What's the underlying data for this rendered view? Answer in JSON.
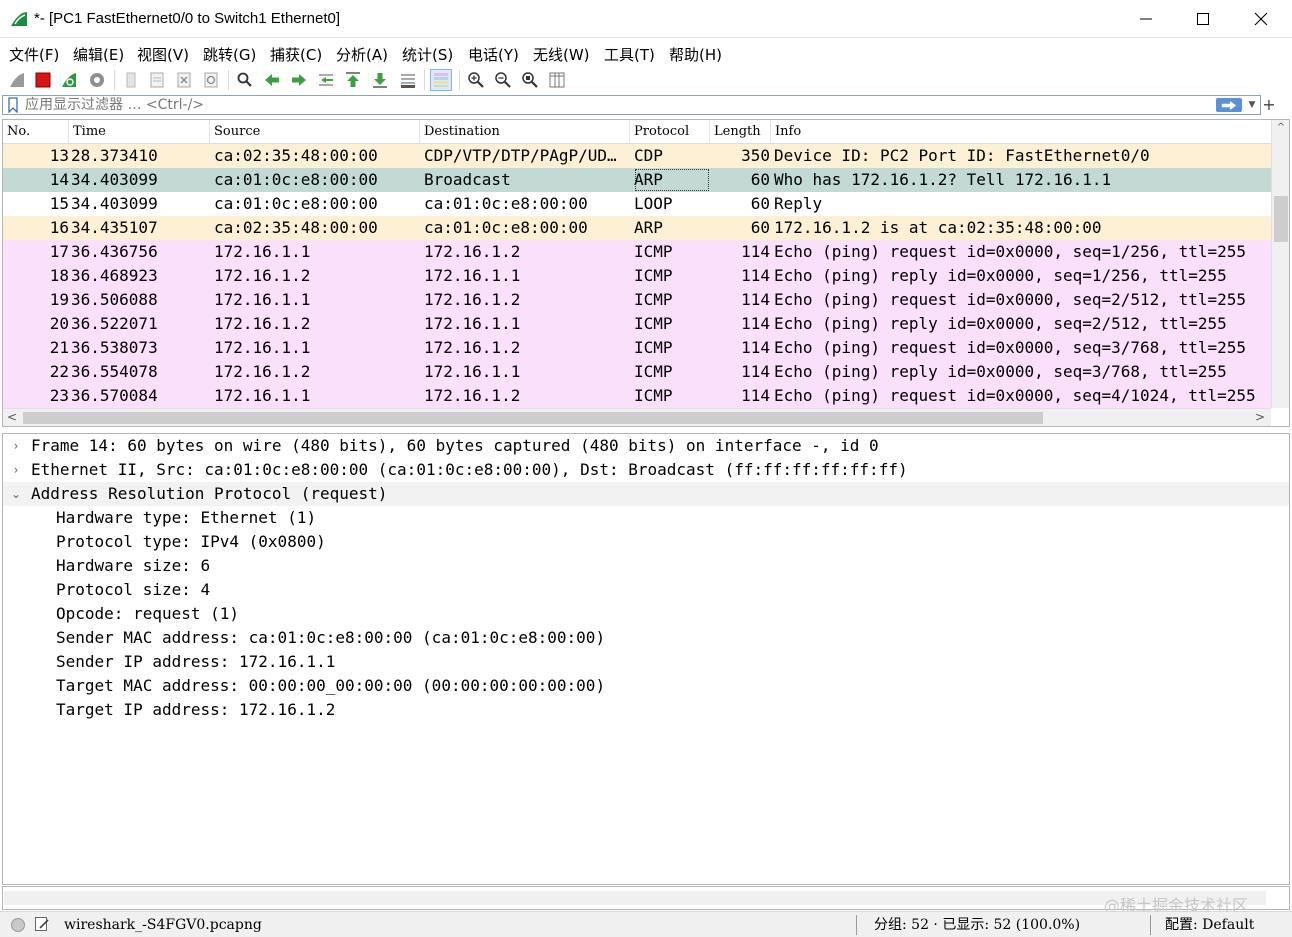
{
  "window": {
    "title": "*- [PC1 FastEthernet0/0 to Switch1 Ethernet0]",
    "icon": "wireshark-fin-icon",
    "controls": [
      "minimize-icon",
      "maximize-icon",
      "close-icon"
    ]
  },
  "menu": [
    "文件(F)",
    "编辑(E)",
    "视图(V)",
    "跳转(G)",
    "捕获(C)",
    "分析(A)",
    "统计(S)",
    "电话(Y)",
    "无线(W)",
    "工具(T)",
    "帮助(H)"
  ],
  "toolbar": {
    "icons": [
      "start-capture-icon",
      "stop-capture-icon",
      "restart-capture-icon",
      "capture-options-icon",
      "open-file-icon",
      "save-file-icon",
      "close-file-icon",
      "reload-file-icon",
      "find-packet-icon",
      "go-back-icon",
      "go-forward-icon",
      "go-to-packet-icon",
      "first-packet-icon",
      "last-packet-icon",
      "autoscroll-icon",
      "colorize-icon",
      "zoom-in-icon",
      "zoom-out-icon",
      "normal-size-icon",
      "resize-columns-icon"
    ]
  },
  "filter": {
    "placeholder": "应用显示过滤器 … <Ctrl-/>",
    "value": "",
    "add_label": "+"
  },
  "packet_list": {
    "columns": [
      "No.",
      "Time",
      "Source",
      "Destination",
      "Protocol",
      "Length",
      "Info"
    ],
    "rows": [
      {
        "no": "13",
        "time": "28.373410",
        "src": "ca:02:35:48:00:00",
        "dst": "CDP/VTP/DTP/PAgP/UD…",
        "proto": "CDP",
        "len": "350",
        "info": "Device ID: PC2  Port ID: FastEthernet0/0",
        "bg": "#fdf0d5"
      },
      {
        "no": "14",
        "time": "34.403099",
        "src": "ca:01:0c:e8:00:00",
        "dst": "Broadcast",
        "proto": "ARP",
        "len": "60",
        "info": "Who has 172.16.1.2? Tell 172.16.1.1",
        "bg": "#c3d9d3"
      },
      {
        "no": "15",
        "time": "34.403099",
        "src": "ca:01:0c:e8:00:00",
        "dst": "ca:01:0c:e8:00:00",
        "proto": "LOOP",
        "len": "60",
        "info": "Reply",
        "bg": "#ffffff"
      },
      {
        "no": "16",
        "time": "34.435107",
        "src": "ca:02:35:48:00:00",
        "dst": "ca:01:0c:e8:00:00",
        "proto": "ARP",
        "len": "60",
        "info": "172.16.1.2 is at ca:02:35:48:00:00",
        "bg": "#fdf0d5"
      },
      {
        "no": "17",
        "time": "36.436756",
        "src": "172.16.1.1",
        "dst": "172.16.1.2",
        "proto": "ICMP",
        "len": "114",
        "info": "Echo (ping) request  id=0x0000, seq=1/256, ttl=255",
        "bg": "#fbe0fb"
      },
      {
        "no": "18",
        "time": "36.468923",
        "src": "172.16.1.2",
        "dst": "172.16.1.1",
        "proto": "ICMP",
        "len": "114",
        "info": "Echo (ping) reply    id=0x0000, seq=1/256, ttl=255",
        "bg": "#fbe0fb"
      },
      {
        "no": "19",
        "time": "36.506088",
        "src": "172.16.1.1",
        "dst": "172.16.1.2",
        "proto": "ICMP",
        "len": "114",
        "info": "Echo (ping) request  id=0x0000, seq=2/512, ttl=255",
        "bg": "#fbe0fb"
      },
      {
        "no": "20",
        "time": "36.522071",
        "src": "172.16.1.2",
        "dst": "172.16.1.1",
        "proto": "ICMP",
        "len": "114",
        "info": "Echo (ping) reply    id=0x0000, seq=2/512, ttl=255",
        "bg": "#fbe0fb"
      },
      {
        "no": "21",
        "time": "36.538073",
        "src": "172.16.1.1",
        "dst": "172.16.1.2",
        "proto": "ICMP",
        "len": "114",
        "info": "Echo (ping) request  id=0x0000, seq=3/768, ttl=255",
        "bg": "#fbe0fb"
      },
      {
        "no": "22",
        "time": "36.554078",
        "src": "172.16.1.2",
        "dst": "172.16.1.1",
        "proto": "ICMP",
        "len": "114",
        "info": "Echo (ping) reply    id=0x0000, seq=3/768, ttl=255",
        "bg": "#fbe0fb"
      },
      {
        "no": "23",
        "time": "36.570084",
        "src": "172.16.1.1",
        "dst": "172.16.1.2",
        "proto": "ICMP",
        "len": "114",
        "info": "Echo (ping) request  id=0x0000, seq=4/1024, ttl=255",
        "bg": "#fbe0fb"
      }
    ]
  },
  "details": [
    {
      "text": "Frame 14: 60 bytes on wire (480 bits), 60 bytes captured (480 bits) on interface -, id 0",
      "arrow": "›",
      "indent": 0
    },
    {
      "text": "Ethernet II, Src: ca:01:0c:e8:00:00 (ca:01:0c:e8:00:00), Dst: Broadcast (ff:ff:ff:ff:ff:ff)",
      "arrow": "›",
      "indent": 0
    },
    {
      "text": "Address Resolution Protocol (request)",
      "arrow": "⌄",
      "indent": 0
    },
    {
      "text": "Hardware type: Ethernet (1)",
      "arrow": "",
      "indent": 1
    },
    {
      "text": "Protocol type: IPv4 (0x0800)",
      "arrow": "",
      "indent": 1
    },
    {
      "text": "Hardware size: 6",
      "arrow": "",
      "indent": 1
    },
    {
      "text": "Protocol size: 4",
      "arrow": "",
      "indent": 1
    },
    {
      "text": "Opcode: request (1)",
      "arrow": "",
      "indent": 1
    },
    {
      "text": "Sender MAC address: ca:01:0c:e8:00:00 (ca:01:0c:e8:00:00)",
      "arrow": "",
      "indent": 1
    },
    {
      "text": "Sender IP address: 172.16.1.1",
      "arrow": "",
      "indent": 1
    },
    {
      "text": "Target MAC address: 00:00:00_00:00:00 (00:00:00:00:00:00)",
      "arrow": "",
      "indent": 1
    },
    {
      "text": "Target IP address: 172.16.1.2",
      "arrow": "",
      "indent": 1
    }
  ],
  "statusbar": {
    "file": "wireshark_-S4FGV0.pcapng",
    "packets": "分组: 52 · 已显示: 52 (100.0%)",
    "profile": "配置: Default"
  },
  "watermark": "@稀土掘金技术社区"
}
